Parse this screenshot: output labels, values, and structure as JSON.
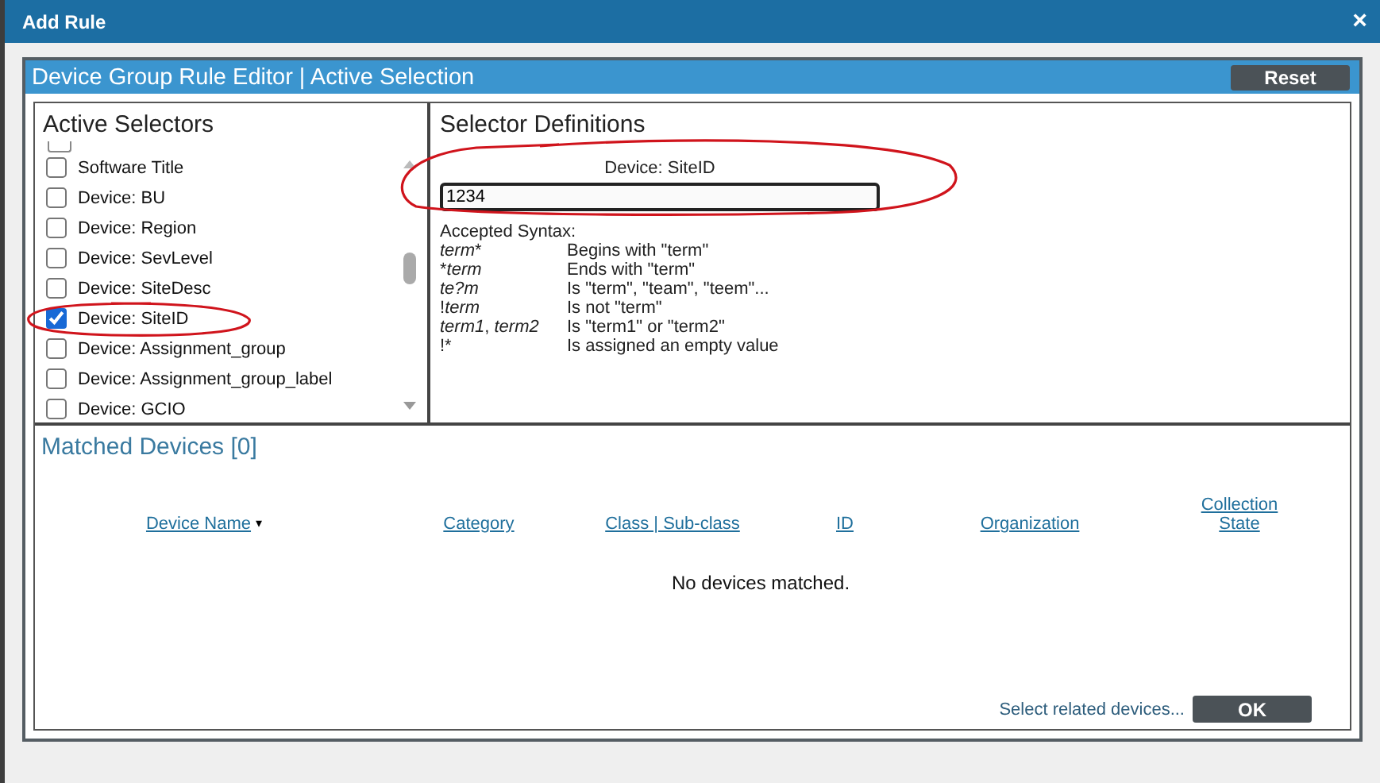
{
  "window": {
    "title": "Add Rule",
    "close": "×"
  },
  "editor": {
    "title": "Device Group Rule Editor | Active Selection",
    "reset_button": "Reset"
  },
  "selectors": {
    "title": "Active Selectors",
    "items": [
      {
        "label": "Software Title",
        "checked": false
      },
      {
        "label": "Device: BU",
        "checked": false
      },
      {
        "label": "Device: Region",
        "checked": false
      },
      {
        "label": "Device: SevLevel",
        "checked": false
      },
      {
        "label": "Device: SiteDesc",
        "checked": false
      },
      {
        "label": "Device: SiteID",
        "checked": true
      },
      {
        "label": "Device: Assignment_group",
        "checked": false
      },
      {
        "label": "Device: Assignment_group_label",
        "checked": false
      },
      {
        "label": "Device: GCIO",
        "checked": false
      }
    ]
  },
  "definitions": {
    "title": "Selector Definitions",
    "field_label": "Device: SiteID",
    "value": "1234",
    "syntax_title": "Accepted Syntax:",
    "syntax": [
      {
        "pattern": [
          {
            "text": "term",
            "italic": true
          },
          {
            "text": "*",
            "italic": false
          }
        ],
        "meaning": "Begins with \"term\""
      },
      {
        "pattern": [
          {
            "text": "*",
            "italic": false
          },
          {
            "text": "term",
            "italic": true
          }
        ],
        "meaning": "Ends with \"term\""
      },
      {
        "pattern": [
          {
            "text": "te?m",
            "italic": true
          }
        ],
        "meaning": "Is \"term\", \"team\", \"teem\"..."
      },
      {
        "pattern": [
          {
            "text": "!",
            "italic": false
          },
          {
            "text": "term",
            "italic": true
          }
        ],
        "meaning": "Is not \"term\""
      },
      {
        "pattern": [
          {
            "text": "term1",
            "italic": true
          },
          {
            "text": ", ",
            "italic": false
          },
          {
            "text": "term2",
            "italic": true
          }
        ],
        "meaning": "Is \"term1\" or \"term2\""
      },
      {
        "pattern": [
          {
            "text": "!*",
            "italic": false
          }
        ],
        "meaning": "Is assigned an empty value"
      }
    ]
  },
  "matched": {
    "title": "Matched Devices [0]",
    "columns": [
      {
        "label": "Device Name",
        "sort_icon": "▾"
      },
      {
        "label": "Category"
      },
      {
        "label": "Class | Sub-class"
      },
      {
        "label": "ID"
      },
      {
        "label": "Organization"
      },
      {
        "label": "Collection State"
      }
    ],
    "empty_message": "No devices matched.",
    "related_link": "Select related devices...",
    "ok_button": "OK"
  }
}
